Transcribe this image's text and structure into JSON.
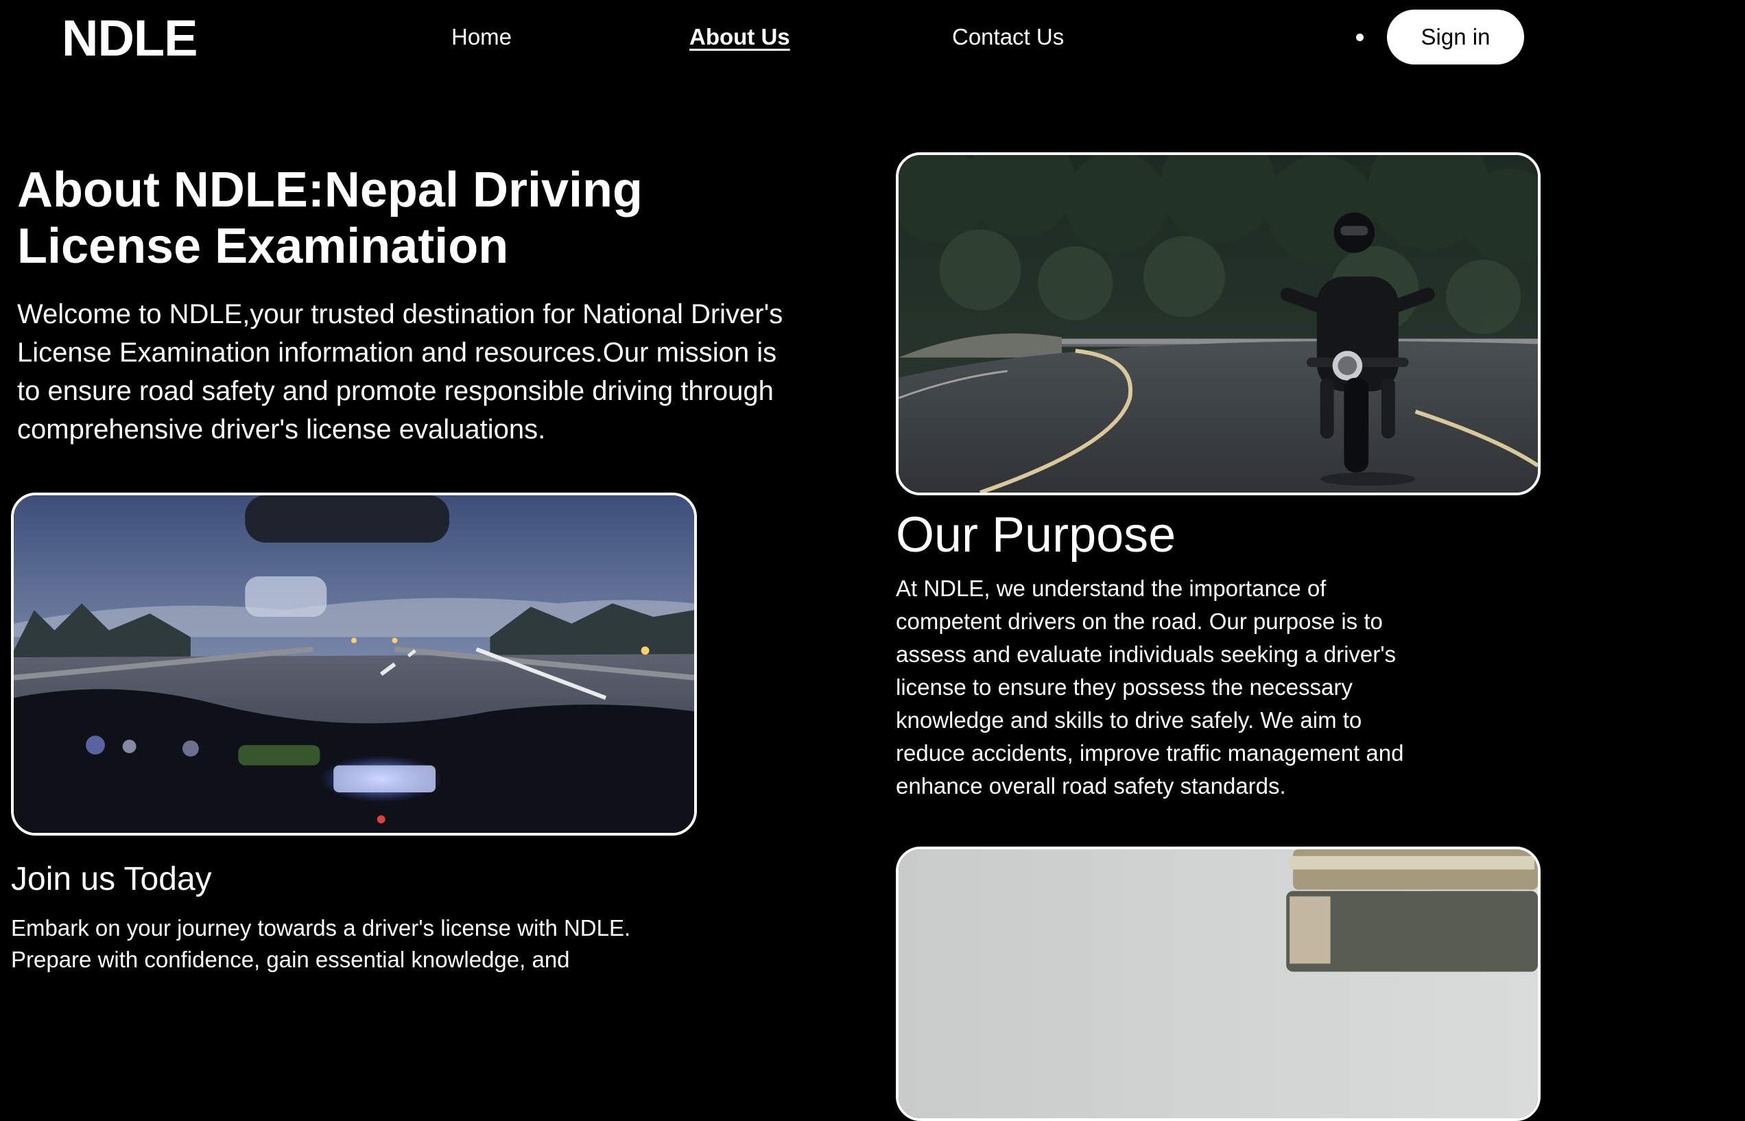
{
  "nav": {
    "logo": "NDLE",
    "links": [
      {
        "label": "Home"
      },
      {
        "label": "About Us",
        "active": true
      },
      {
        "label": "Contact Us"
      }
    ],
    "sign_in_label": "Sign in"
  },
  "hero": {
    "title": "About NDLE:Nepal Driving License Examination",
    "text": "Welcome to NDLE,your trusted destination for National Driver's License Examination information and resources.Our mission is to ensure road safety and promote responsible driving through comprehensive driver's license evaluations."
  },
  "purpose": {
    "title": "Our Purpose",
    "text": "At NDLE, we understand the importance of competent drivers on the road. Our purpose is to assess and evaluate individuals seeking a driver's license to ensure they possess the necessary knowledge and skills to drive safely. We aim to reduce accidents, improve traffic management and enhance overall road safety standards."
  },
  "join": {
    "title": "Join us Today",
    "text": "Embark on your journey towards a driver's license with NDLE. Prepare with confidence, gain essential knowledge, and"
  },
  "colors": {
    "background": "#000000",
    "text": "#ffffff",
    "button_bg": "#ffffff",
    "button_text": "#000000"
  }
}
